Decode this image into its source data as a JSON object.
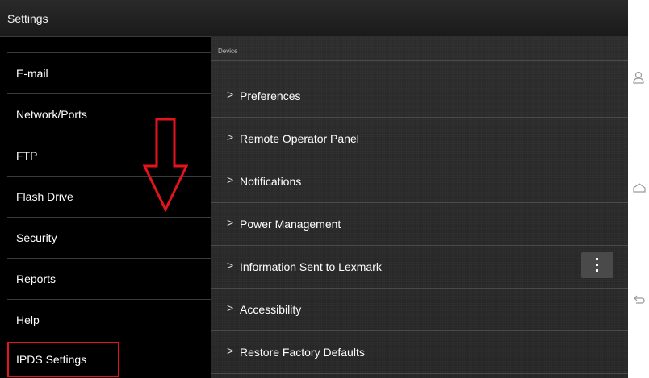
{
  "window": {
    "title": "Settings"
  },
  "sidebar": {
    "items": [
      {
        "label": "E-mail"
      },
      {
        "label": "Network/Ports"
      },
      {
        "label": "FTP"
      },
      {
        "label": "Flash Drive"
      },
      {
        "label": "Security"
      },
      {
        "label": "Reports"
      },
      {
        "label": "Help"
      },
      {
        "label": "IPDS Settings"
      }
    ]
  },
  "main": {
    "section_header": "Device",
    "rows": [
      {
        "label": "Preferences"
      },
      {
        "label": "Remote Operator Panel"
      },
      {
        "label": "Notifications"
      },
      {
        "label": "Power Management"
      },
      {
        "label": "Information Sent to Lexmark"
      },
      {
        "label": "Accessibility"
      },
      {
        "label": "Restore Factory Defaults"
      }
    ],
    "chevron": ">"
  },
  "annotation": {
    "color": "#e5131e"
  },
  "icons": [
    "down-arrow-annotation-icon",
    "more-options-icon",
    "profile-icon",
    "home-icon",
    "back-icon"
  ]
}
